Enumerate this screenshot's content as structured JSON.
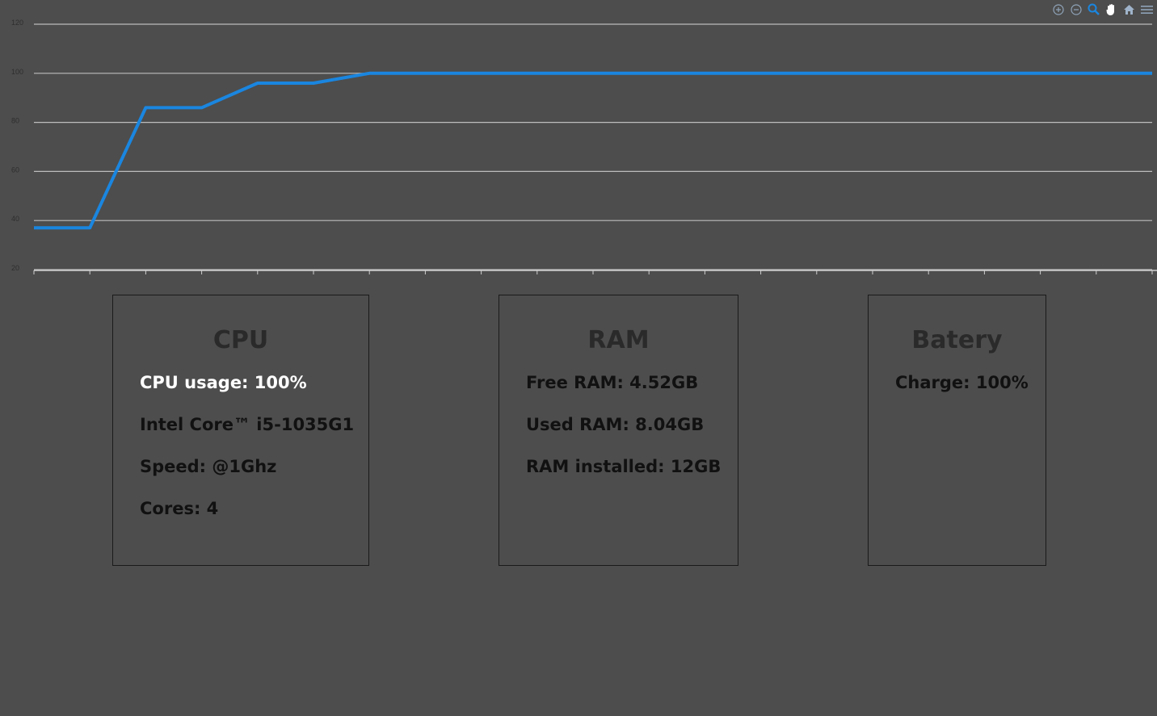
{
  "colors": {
    "background": "#4d4d4d",
    "line": "#1a86e0",
    "grid": "#bdbdbd"
  },
  "toolbar": {
    "icons": [
      "zoom-in-icon",
      "zoom-out-icon",
      "selection-zoom-icon",
      "pan-icon",
      "home-icon",
      "menu-icon"
    ]
  },
  "chart_data": {
    "type": "line",
    "title": "",
    "xlabel": "",
    "ylabel": "",
    "ylim": [
      20,
      120
    ],
    "yticks": [
      20,
      40,
      60,
      80,
      100,
      120
    ],
    "x_tick_count": 21,
    "grid": true,
    "series": [
      {
        "values": [
          37,
          37,
          86,
          86,
          96,
          96,
          100,
          100,
          100,
          100,
          100,
          100,
          100,
          100,
          100,
          100,
          100,
          100,
          100,
          100,
          100
        ]
      }
    ]
  },
  "cards": {
    "cpu": {
      "title": "CPU",
      "usage": "CPU usage: 100%",
      "model": "Intel Core™ i5-1035G1",
      "speed": "Speed: @1Ghz",
      "cores": "Cores: 4"
    },
    "ram": {
      "title": "RAM",
      "free": "Free RAM: 4.52GB",
      "used": "Used RAM: 8.04GB",
      "installed": "RAM installed: 12GB"
    },
    "battery": {
      "title": "Batery",
      "charge": "Charge: 100%"
    }
  }
}
